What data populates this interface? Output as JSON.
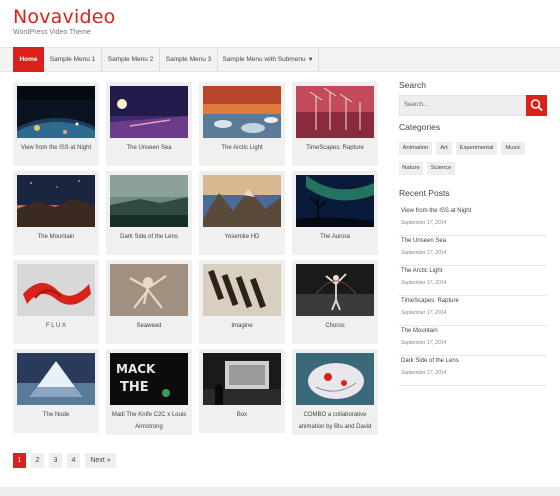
{
  "site": {
    "title": "Novavideo",
    "tagline": "WordPress Video Theme"
  },
  "nav": {
    "items": [
      {
        "label": "Home",
        "active": true
      },
      {
        "label": "Sample Menu 1"
      },
      {
        "label": "Sample Menu 2"
      },
      {
        "label": "Sample Menu 3"
      },
      {
        "label": "Sample Menu with Submenu",
        "caret": "▼"
      }
    ]
  },
  "videos": [
    {
      "title": "View from the ISS at Night"
    },
    {
      "title": "The Unseen Sea"
    },
    {
      "title": "The Arctic Light"
    },
    {
      "title": "TimeScapes: Rapture"
    },
    {
      "title": "The Mountain"
    },
    {
      "title": "Dark Side of the Lens"
    },
    {
      "title": "Yosemite HD"
    },
    {
      "title": "The Aurora"
    },
    {
      "title": "F L U X"
    },
    {
      "title": "Seaweed"
    },
    {
      "title": "Imagine"
    },
    {
      "title": "Choros"
    },
    {
      "title": "The Node"
    },
    {
      "title": "Madi The Knife C2C x Louis Armstrong"
    },
    {
      "title": "Box"
    },
    {
      "title": "COMBO a collaborative animation by Blu and David"
    }
  ],
  "pagination": {
    "pages": [
      "1",
      "2",
      "3",
      "4"
    ],
    "next_label": "Next »",
    "current": "1"
  },
  "sidebar": {
    "search_title": "Search",
    "search_placeholder": "Search...",
    "categories_title": "Categories",
    "categories": [
      "Animation",
      "Art",
      "Experimental",
      "Music",
      "Nature",
      "Science"
    ],
    "recent_title": "Recent Posts",
    "recent_posts": [
      {
        "title": "View from the ISS at Night",
        "date": "September 17, 2014"
      },
      {
        "title": "The Unseen Sea",
        "date": "September 17, 2014"
      },
      {
        "title": "The Arctic Light",
        "date": "September 17, 2014"
      },
      {
        "title": "TimeScapes: Rapture",
        "date": "September 17, 2014"
      },
      {
        "title": "The Mountain",
        "date": "September 17, 2014"
      },
      {
        "title": "Dark Side of the Lens",
        "date": "September 17, 2014"
      }
    ]
  },
  "colors": {
    "accent": "#d9221c",
    "nav_bg": "#f3f3f3",
    "card_bg": "#f0f0f0"
  }
}
